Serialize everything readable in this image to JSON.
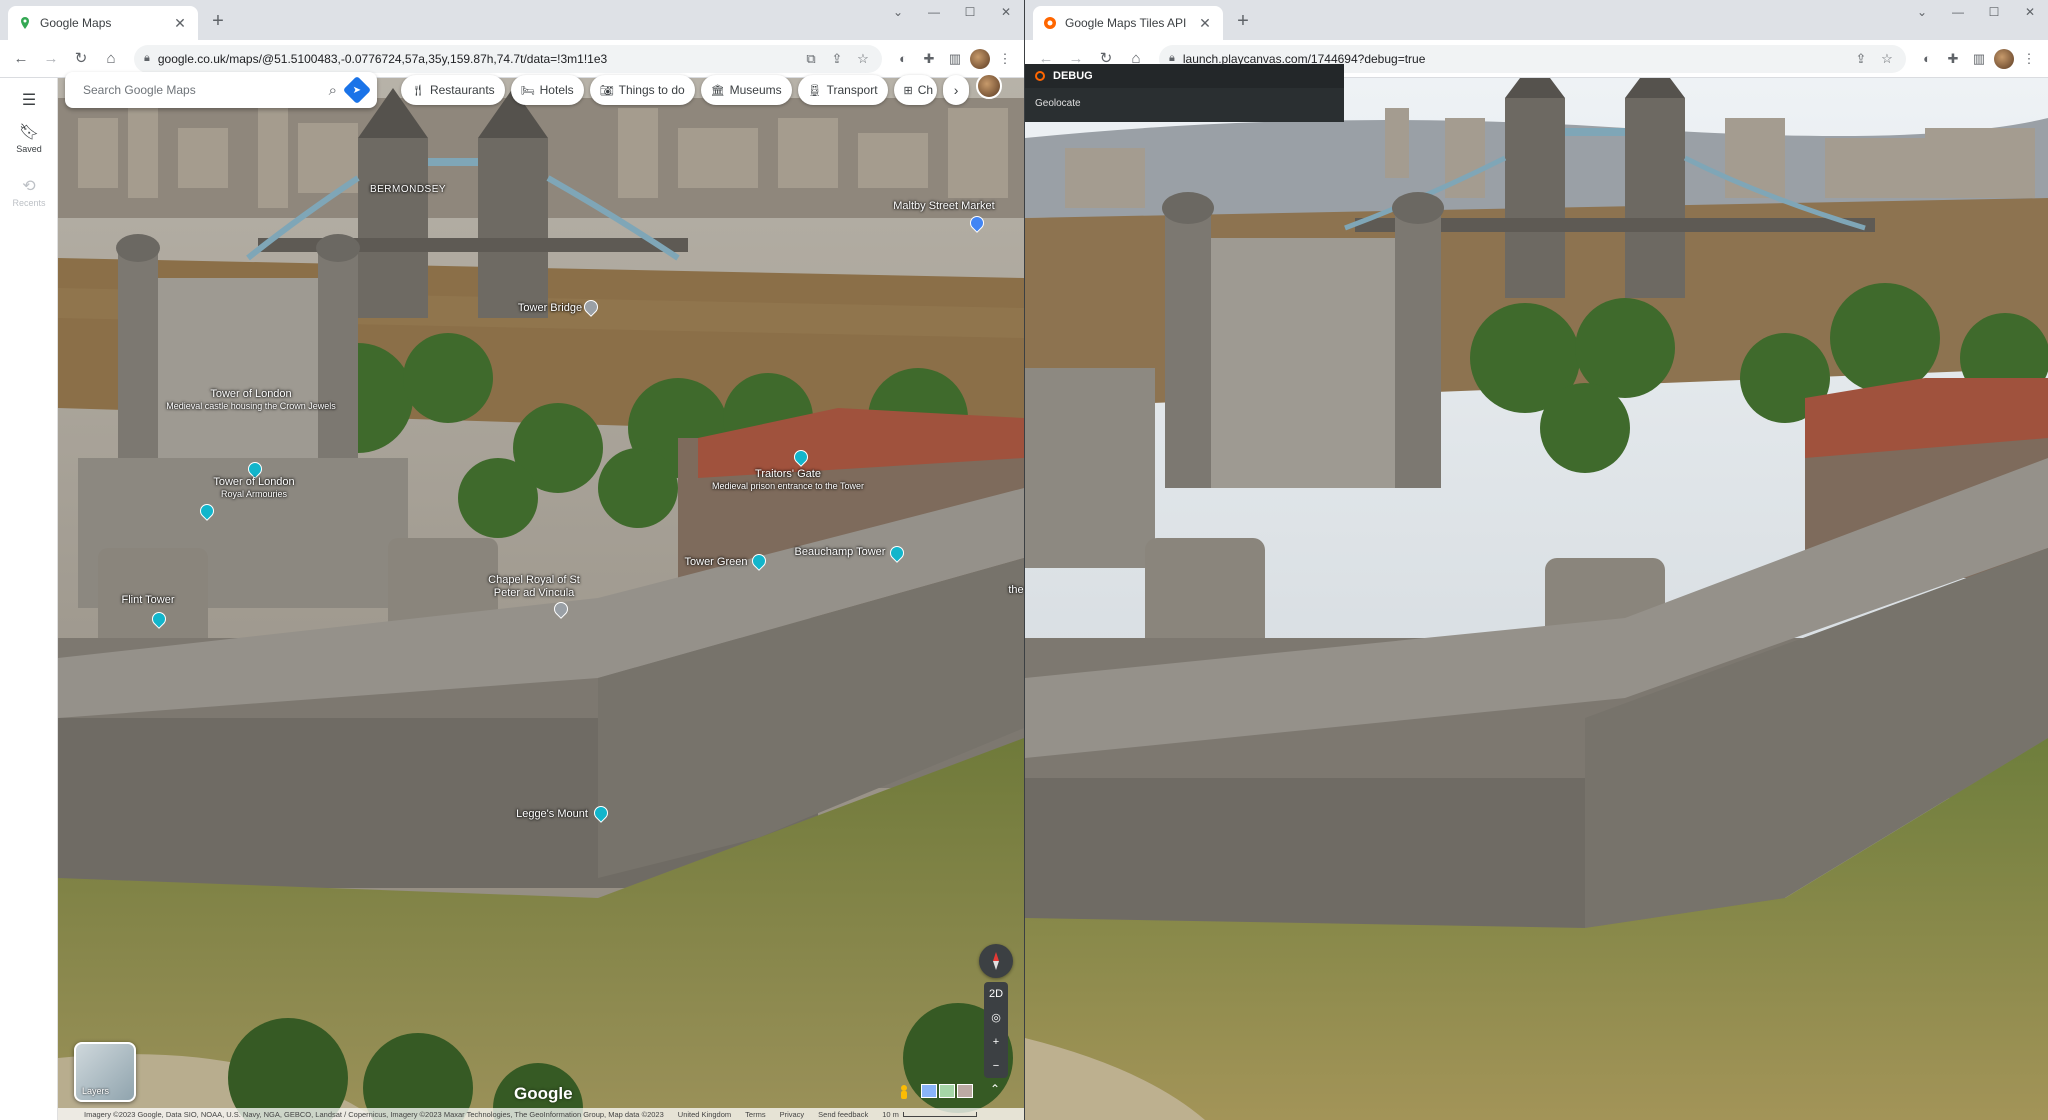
{
  "left": {
    "tab": {
      "title": "Google Maps"
    },
    "url": "google.co.uk/maps/@51.5100483,-0.0776724,57a,35y,159.87h,74.7t/data=!3m1!1e3",
    "rail": {
      "saved": "Saved",
      "recents": "Recents"
    },
    "search": {
      "placeholder": "Search Google Maps"
    },
    "chips": [
      {
        "label": "Restaurants",
        "icon": "fork-knife-icon"
      },
      {
        "label": "Hotels",
        "icon": "bed-icon"
      },
      {
        "label": "Things to do",
        "icon": "camera-icon"
      },
      {
        "label": "Museums",
        "icon": "museum-icon"
      },
      {
        "label": "Transport",
        "icon": "train-icon"
      },
      {
        "label": "Ch",
        "icon": "pharmacy-icon"
      }
    ],
    "places": {
      "bermondsey": "BERMONDSEY",
      "maltby": "Maltby Street Market",
      "tower_bridge": "Tower Bridge",
      "tower_of_london_1": "Tower of London",
      "tower_of_london_1_sub": "Medieval castle housing the Crown Jewels",
      "tower_of_london_2": "Tower of London",
      "tower_of_london_2_sub": "Royal Armouries",
      "traitors_gate": "Traitors' Gate",
      "traitors_gate_sub": "Medieval prison entrance to the Tower",
      "beauchamp": "Beauchamp Tower",
      "tower_green": "Tower Green",
      "chapel": "Chapel Royal of St Peter ad Vincula",
      "flint": "Flint Tower",
      "legges": "Legge's Mount",
      "edge_the": "the"
    },
    "controls": {
      "two_d": "2D",
      "layers": "Layers"
    },
    "logo": "Google",
    "attribution": {
      "imagery": "Imagery ©2023 Google, Data SIO, NOAA, U.S. Navy, NGA, GEBCO, Landsat / Copernicus, Imagery ©2023 Maxar Technologies, The GeoInformation Group, Map data ©2023",
      "country": "United Kingdom",
      "terms": "Terms",
      "privacy": "Privacy",
      "feedback": "Send feedback",
      "scale": "10 m"
    }
  },
  "right": {
    "tab": {
      "title": "Google Maps Tiles API | Launch"
    },
    "url": "launch.playcanvas.com/1744694?debug=true",
    "debug": {
      "title": "DEBUG",
      "button": "Geolocate"
    }
  },
  "colors": {
    "accent": "#1a73e8",
    "pin_teal": "#12b5cb",
    "debug_orange": "#ff6600",
    "river": "#8b6f48",
    "stone": "#8e8a82"
  }
}
